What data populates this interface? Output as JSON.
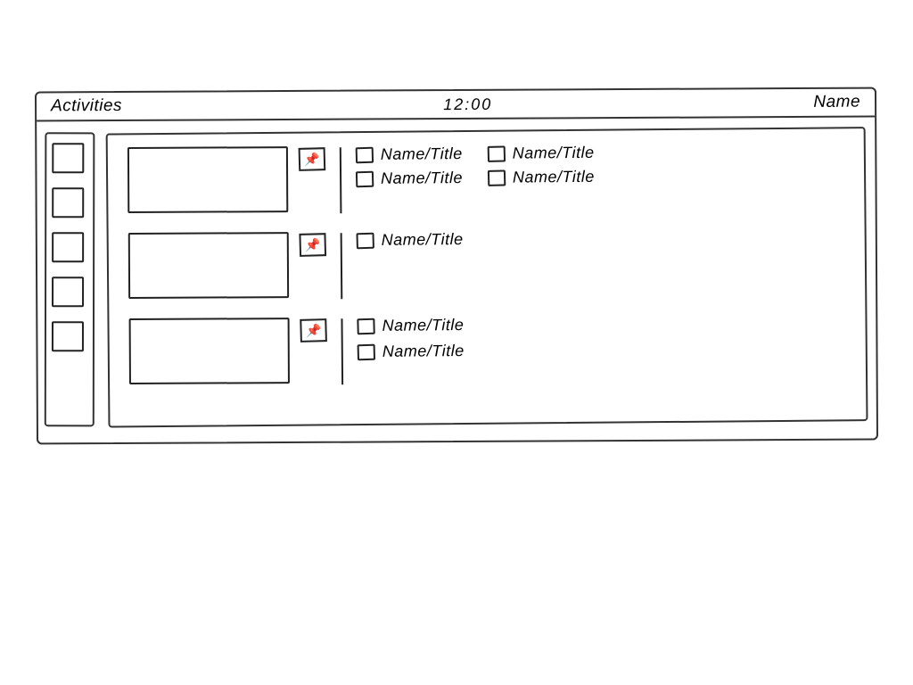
{
  "topbar": {
    "left_label": "Activities",
    "center_label": "12:00",
    "right_label": "Name"
  },
  "sidebar": {
    "items": [
      {
        "index": 0
      },
      {
        "index": 1
      },
      {
        "index": 2
      },
      {
        "index": 3
      },
      {
        "index": 4
      }
    ]
  },
  "rows": [
    {
      "pin_glyph": "📌",
      "windows": [
        {
          "label": "Name/Title"
        },
        {
          "label": "Name/Title"
        },
        {
          "label": "Name/Title"
        },
        {
          "label": "Name/Title"
        }
      ]
    },
    {
      "pin_glyph": "📌",
      "windows": [
        {
          "label": "Name/Title"
        }
      ]
    },
    {
      "pin_glyph": "📌",
      "windows": [
        {
          "label": "Name/Title"
        },
        {
          "label": "Name/Title"
        }
      ]
    }
  ]
}
